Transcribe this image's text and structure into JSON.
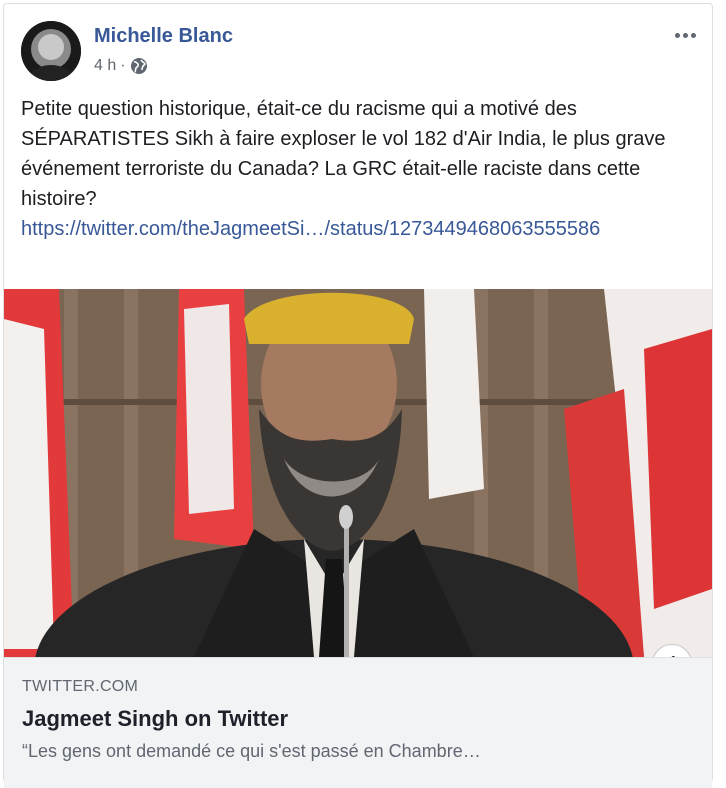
{
  "post": {
    "author": "Michelle Blanc",
    "time": "4 h",
    "separator": "·",
    "privacy_icon": "globe-icon",
    "more_icon": "more-options-icon",
    "text": "Petite question historique, était-ce du racisme qui a motivé des SÉPARATISTES Sikh à faire exploser le vol 182 d'Air India, le plus grave événement terroriste du Canada? La GRC était-elle raciste dans cette histoire?",
    "link": "https://twitter.com/theJagmeetSi…/status/1273449468063555586"
  },
  "preview": {
    "domain": "TWITTER.COM",
    "title": "Jagmeet Singh on Twitter",
    "description": "“Les gens ont demandé ce qui s'est passé en Chambre…",
    "info_icon": "info-icon",
    "info_glyph": "i"
  },
  "colors": {
    "link": "#385898",
    "secondary_text": "#606770",
    "preview_bg": "#f2f3f5"
  }
}
